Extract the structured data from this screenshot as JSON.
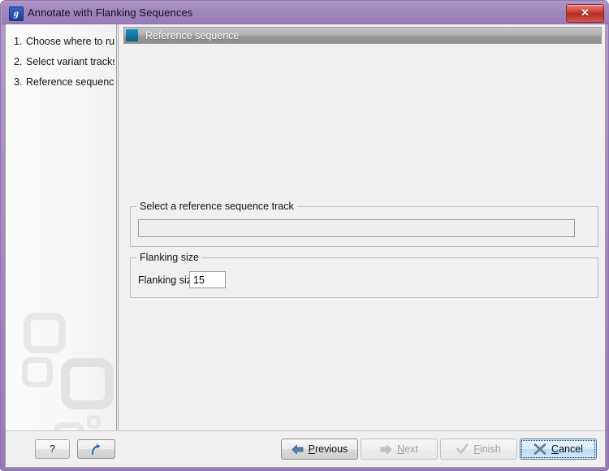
{
  "window": {
    "title": "Annotate with Flanking Sequences",
    "icon": "app-logo-icon",
    "close_label": "✕"
  },
  "sidebar": {
    "steps": [
      {
        "num": "1.",
        "label": "Choose where to run"
      },
      {
        "num": "2.",
        "label": "Select variant tracks"
      },
      {
        "num": "3.",
        "label": "Reference sequence"
      }
    ]
  },
  "panel": {
    "header_title": "Reference sequence",
    "reference_group": {
      "title": "Select a reference sequence track",
      "input_value": "",
      "input_placeholder": "",
      "browse_icon": "folder-search-icon"
    },
    "flanking_group": {
      "title": "Flanking size",
      "field_label": "Flanking size",
      "field_value": "15"
    }
  },
  "bottom": {
    "help_label": "?",
    "reset_icon": "reset-arrow-icon",
    "buttons": [
      {
        "name": "previous",
        "label_pre": "",
        "mnemonic": "P",
        "label_post": "revious",
        "icon": "arrow-left-icon",
        "state": "enabled"
      },
      {
        "name": "next",
        "label_pre": "",
        "mnemonic": "N",
        "label_post": "ext",
        "icon": "arrow-right-icon",
        "state": "disabled"
      },
      {
        "name": "finish",
        "label_pre": "",
        "mnemonic": "F",
        "label_post": "inish",
        "icon": "check-icon",
        "state": "disabled"
      },
      {
        "name": "cancel",
        "label_pre": "",
        "mnemonic": "C",
        "label_post": "ancel",
        "icon": "x-mark-icon",
        "state": "focused"
      }
    ]
  },
  "colors": {
    "title_bar": "#9a7cb8",
    "panel_bg": "#f0f0f0",
    "header_bar": "#9b9b9b",
    "header_icon": "#1577ad",
    "close_button": "#b22f24",
    "focus_border": "#3c7fb1"
  }
}
